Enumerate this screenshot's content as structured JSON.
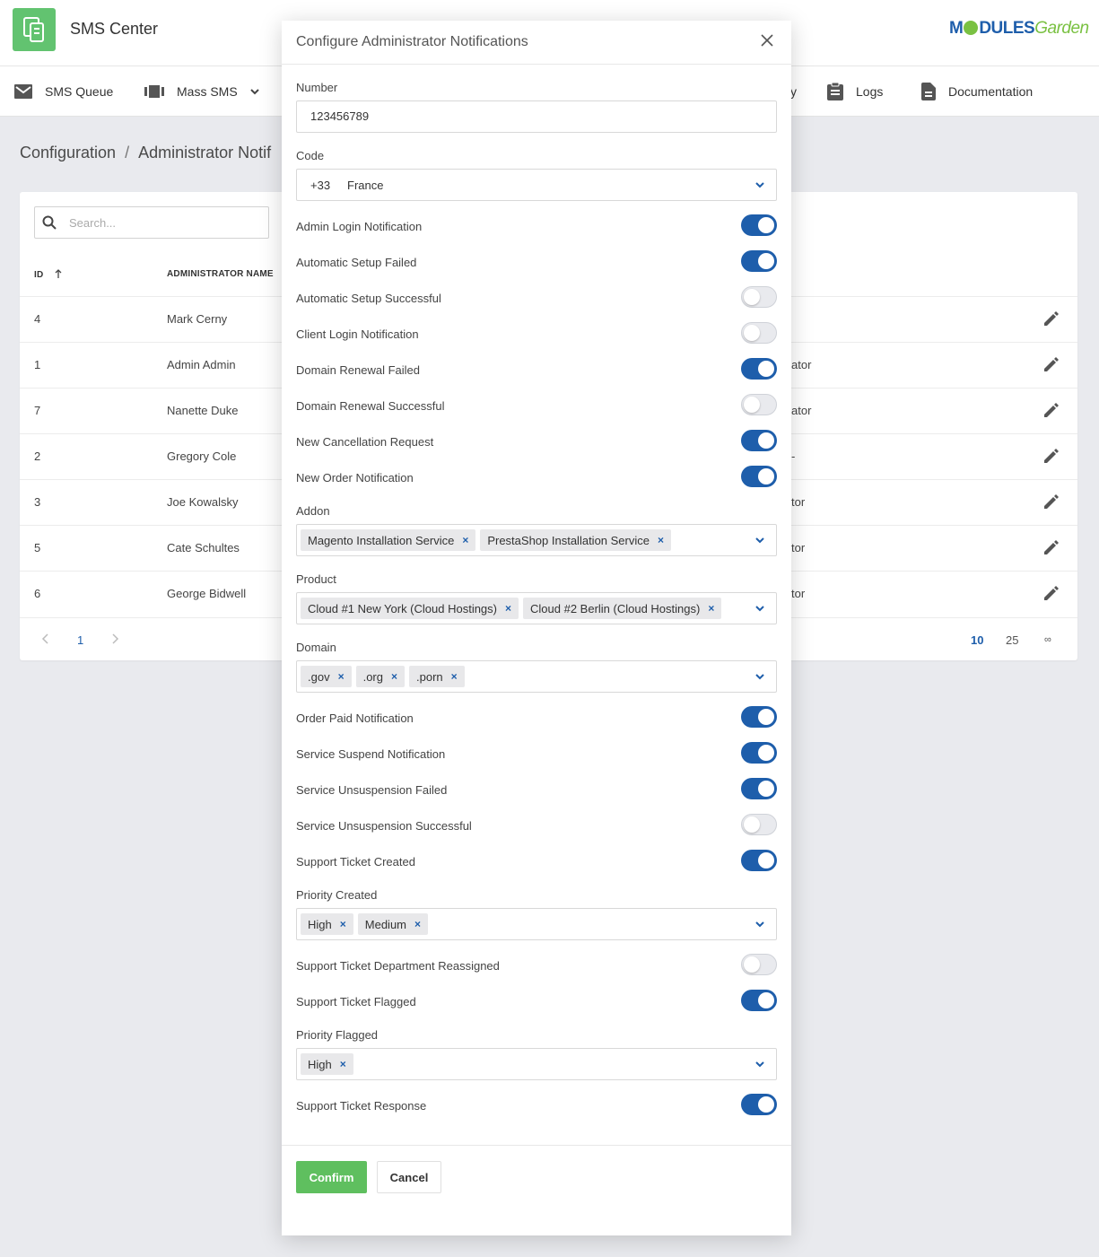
{
  "app": {
    "title": "SMS Center"
  },
  "brand": {
    "part1": "M",
    "part2": "DULES",
    "part3": "Garden"
  },
  "nav": [
    {
      "label": "SMS Queue",
      "icon": "envelope-icon"
    },
    {
      "label": "Mass SMS",
      "icon": "mass-sms-icon"
    },
    {
      "label": "y",
      "icon": ""
    },
    {
      "label": "Logs",
      "icon": "clipboard-icon"
    },
    {
      "label": "Documentation",
      "icon": "document-icon"
    }
  ],
  "breadcrumb": {
    "root": "Configuration",
    "separator": "/",
    "current": "Administrator Notif"
  },
  "table": {
    "search_placeholder": "Search...",
    "headers": {
      "id": "ID",
      "name": "ADMINISTRATOR NAME"
    },
    "rows": [
      {
        "id": "4",
        "name": "Mark Cerny",
        "role": ""
      },
      {
        "id": "1",
        "name": "Admin Admin",
        "role": "ator"
      },
      {
        "id": "7",
        "name": "Nanette Duke",
        "role": "ator"
      },
      {
        "id": "2",
        "name": "Gregory Cole",
        "role": "-"
      },
      {
        "id": "3",
        "name": "Joe Kowalsky",
        "role": "tor"
      },
      {
        "id": "5",
        "name": "Cate Schultes",
        "role": "tor"
      },
      {
        "id": "6",
        "name": "George Bidwell",
        "role": "tor"
      }
    ],
    "pager": {
      "page": "1",
      "size_10": "10",
      "size_25": "25",
      "size_all": "∞"
    }
  },
  "modal": {
    "title": "Configure Administrator Notifications",
    "number": {
      "label": "Number",
      "value": "123456789"
    },
    "code": {
      "label": "Code",
      "dial": "+33",
      "country": "France"
    },
    "toggles_a": [
      {
        "label": "Admin Login Notification",
        "on": true
      },
      {
        "label": "Automatic Setup Failed",
        "on": true
      },
      {
        "label": "Automatic Setup Successful",
        "on": false
      },
      {
        "label": "Client Login Notification",
        "on": false
      },
      {
        "label": "Domain Renewal Failed",
        "on": true
      },
      {
        "label": "Domain Renewal Successful",
        "on": false
      },
      {
        "label": "New Cancellation Request",
        "on": true
      },
      {
        "label": "New Order Notification",
        "on": true
      }
    ],
    "addon": {
      "label": "Addon",
      "tags": [
        "Magento Installation Service",
        "PrestaShop Installation Service"
      ]
    },
    "product": {
      "label": "Product",
      "tags": [
        "Cloud #1 New York (Cloud Hostings)",
        "Cloud #2 Berlin (Cloud Hostings)"
      ]
    },
    "domain": {
      "label": "Domain",
      "tags": [
        ".gov",
        ".org",
        ".porn"
      ]
    },
    "toggles_b": [
      {
        "label": "Order Paid Notification",
        "on": true
      },
      {
        "label": "Service Suspend Notification",
        "on": true
      },
      {
        "label": "Service Unsuspension Failed",
        "on": true
      },
      {
        "label": "Service Unsuspension Successful",
        "on": false
      },
      {
        "label": "Support Ticket Created",
        "on": true
      }
    ],
    "priority_created": {
      "label": "Priority Created",
      "tags": [
        "High",
        "Medium"
      ]
    },
    "toggles_c": [
      {
        "label": "Support Ticket Department Reassigned",
        "on": false
      },
      {
        "label": "Support Ticket Flagged",
        "on": true
      }
    ],
    "priority_flagged": {
      "label": "Priority Flagged",
      "tags": [
        "High"
      ]
    },
    "toggles_d": [
      {
        "label": "Support Ticket Response",
        "on": true
      }
    ],
    "confirm_label": "Confirm",
    "cancel_label": "Cancel"
  },
  "colors": {
    "accent": "#1e5eab",
    "confirm": "#5fbf5f",
    "logo": "#62c370"
  }
}
